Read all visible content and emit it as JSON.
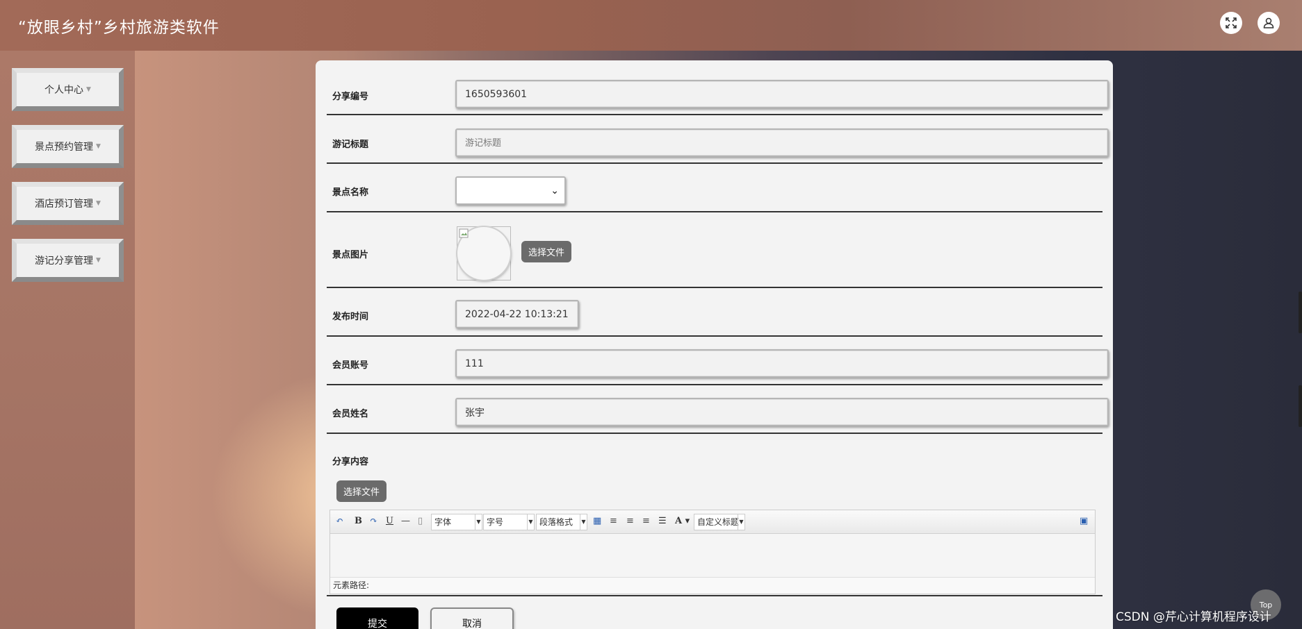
{
  "header": {
    "title": "“放眼乡村”乡村旅游类软件",
    "fullscreen_icon": "fullscreen-icon",
    "user_icon": "user-icon"
  },
  "sidebar": {
    "items": [
      {
        "label": "个人中心"
      },
      {
        "label": "景点预约管理"
      },
      {
        "label": "酒店预订管理"
      },
      {
        "label": "游记分享管理"
      }
    ]
  },
  "form": {
    "share_no": {
      "label": "分享编号",
      "value": "1650593601"
    },
    "title": {
      "label": "游记标题",
      "placeholder": "游记标题"
    },
    "spot_name": {
      "label": "景点名称",
      "value": ""
    },
    "spot_image": {
      "label": "景点图片",
      "button": "选择文件"
    },
    "publish_time": {
      "label": "发布时间",
      "value": "2022-04-22 10:13:21"
    },
    "member_account": {
      "label": "会员账号",
      "value": "111"
    },
    "member_name": {
      "label": "会员姓名",
      "value": "张宇"
    },
    "content": {
      "label": "分享内容",
      "button": "选择文件"
    }
  },
  "editor": {
    "font_combo": "字体",
    "size_combo": "字号",
    "para_combo": "段落格式",
    "custom_combo": "自定义标题",
    "element_path": "元素路径:"
  },
  "actions": {
    "submit": "提交",
    "cancel": "取消"
  },
  "misc": {
    "top_button": "Top",
    "watermark": "CSDN @芹心计算机程序设计"
  }
}
